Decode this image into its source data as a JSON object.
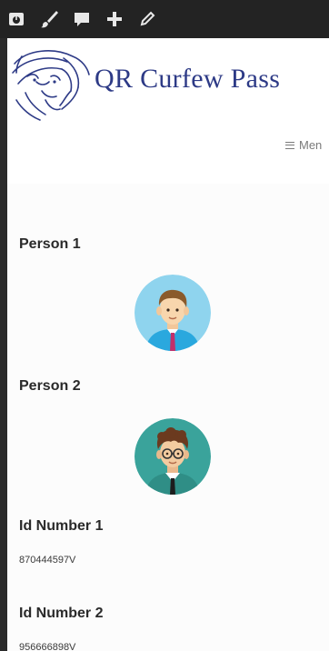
{
  "site": {
    "title": "QR Curfew Pass",
    "logo_icon": "lion-head-icon"
  },
  "admin_bar": {
    "icons": [
      "dashboard-icon",
      "customize-brush-icon",
      "comments-icon",
      "add-new-icon",
      "edit-pencil-icon"
    ]
  },
  "menu": {
    "label": "Men",
    "icon": "hamburger-icon"
  },
  "fields": [
    {
      "label": "Person 1",
      "avatar": "male-avatar-icon"
    },
    {
      "label": "Person 2",
      "avatar": "male-glasses-avatar-icon"
    },
    {
      "label": "Id Number 1",
      "value": "870444597V"
    },
    {
      "label": "Id Number 2",
      "value": "956666898V"
    }
  ],
  "colors": {
    "admin_bar": "#232323",
    "title": "#2d3a86",
    "avatar1_bg": "#8fd4ee",
    "avatar2_bg": "#3aa39b"
  }
}
